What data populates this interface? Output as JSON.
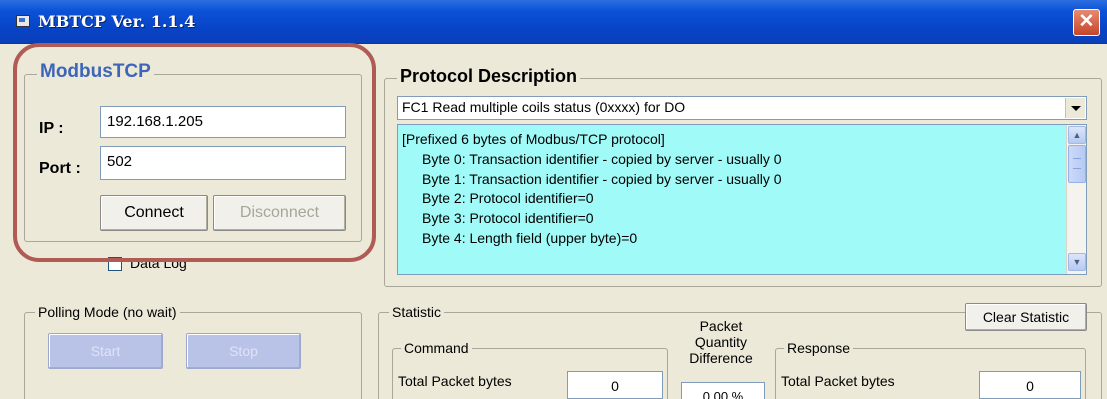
{
  "window": {
    "title": "MBTCP Ver. 1.1.4",
    "close_symbol": "✕",
    "icon": "app-icon"
  },
  "modbus": {
    "legend": "ModbusTCP",
    "ip_label": "IP :",
    "ip_value": "192.168.1.205",
    "port_label": "Port :",
    "port_value": "502",
    "connect_label": "Connect",
    "disconnect_label": "Disconnect",
    "datalog_label": "Data Log"
  },
  "protocol": {
    "legend": "Protocol Description",
    "function_selected": "FC1  Read multiple coils status (0xxxx)  for DO",
    "lines": [
      "[Prefixed 6 bytes of Modbus/TCP protocol]",
      "   Byte 0: Transaction identifier - copied by server - usually 0",
      "   Byte 1: Transaction identifier - copied by server - usually 0",
      "   Byte 2: Protocol identifier=0",
      "   Byte 3: Protocol identifier=0",
      "   Byte 4: Length field (upper byte)=0"
    ],
    "scroll_up": "▲",
    "scroll_down": "▼"
  },
  "polling": {
    "legend": "Polling Mode (no wait)",
    "start_label": "Start",
    "stop_label": "Stop"
  },
  "statistic": {
    "legend": "Statistic",
    "clear_label": "Clear Statistic",
    "command_legend": "Command",
    "response_legend": "Response",
    "packet_quantity_difference": "Packet\nQuantity\nDifference",
    "command_total_label": "Total Packet bytes",
    "command_total_value": "0",
    "response_total_label": "Total Packet bytes",
    "response_total_value": "0",
    "difference_value": "0.00 %"
  },
  "colors": {
    "titlebar": "#0a52d8",
    "annotation": "#b05b54",
    "description_bg": "#9ffaf8",
    "window_bg": "#ece9d8"
  }
}
